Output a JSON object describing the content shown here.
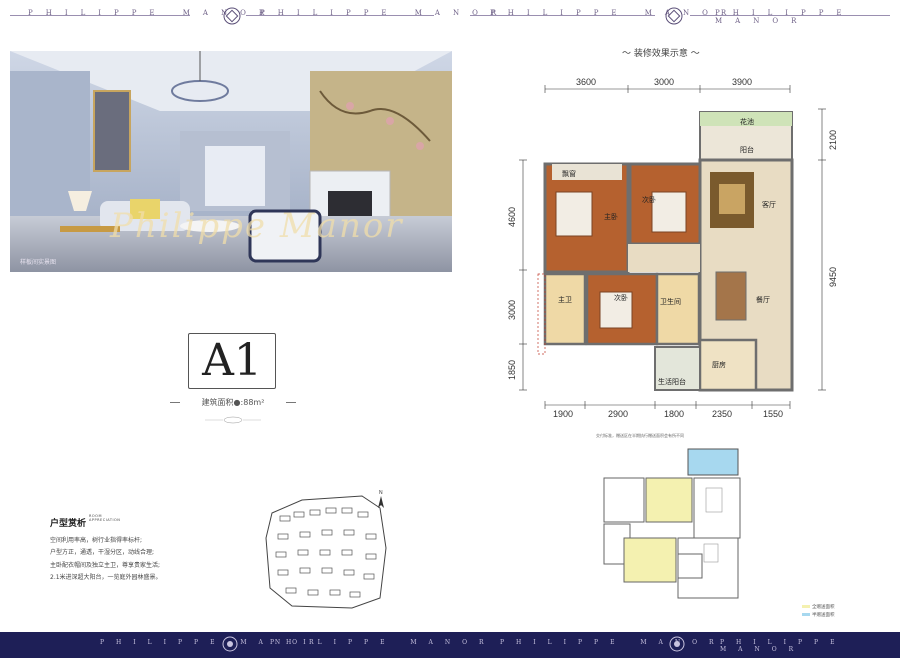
{
  "header": {
    "brand_left": "PHILIPPE MANOR",
    "brand_right": "PHILIPPE MANOR"
  },
  "photo": {
    "caption": "样板间实景图",
    "watermark": "Philippe Manor"
  },
  "unit": {
    "code": "A1",
    "area_text": "建筑面积●:88m²"
  },
  "analysis": {
    "title": "户型赏析",
    "title_en_1": "ROOM",
    "title_en_2": "APPRECIATION",
    "lines": [
      "空间利用率高，树行业指得率标杆;",
      "户型方正，通透，干湿分区，动线合理;",
      "主卧配衣帽间及独立主卫，尊享贵家生活;",
      "2.1米进深超大阳台，一览庭外园林盛景。"
    ]
  },
  "floorplan": {
    "heading": "～ 装修效果示意 ～",
    "top_dims": [
      "3600",
      "3000",
      "3900"
    ],
    "bottom_dims": [
      "1900",
      "2900",
      "1800",
      "2350",
      "1550"
    ],
    "left_dims": [
      "4600",
      "3000",
      "1850"
    ],
    "right_dims": [
      "2100",
      "9450"
    ],
    "rooms": {
      "flower_bed": "花池",
      "balcony": "阳台",
      "bay_window": "飘窗",
      "master_bedroom": "主卧",
      "second_bedroom_a": "次卧",
      "living_room": "客厅",
      "master_bath": "主卫",
      "second_bedroom_b": "次卧",
      "bathroom": "卫生间",
      "dining_room": "餐厅",
      "kitchen": "厨房",
      "utility_balcony": "生活阳台"
    }
  },
  "mini_plan": {
    "note": "交付标准，赠送区在半期执行赠送面积会有所不同",
    "legend_full": "全赠送面积",
    "legend_half": "半赠送面积"
  },
  "footer": {
    "brand_left": "PHILIPPE MANOR",
    "brand_right": "PHILIPPE MANOR"
  },
  "colors": {
    "navy": "#1e1f57",
    "floor_wood": "#b5612f",
    "floor_tile": "#e8dcc3",
    "wall": "#6e6e6e"
  }
}
